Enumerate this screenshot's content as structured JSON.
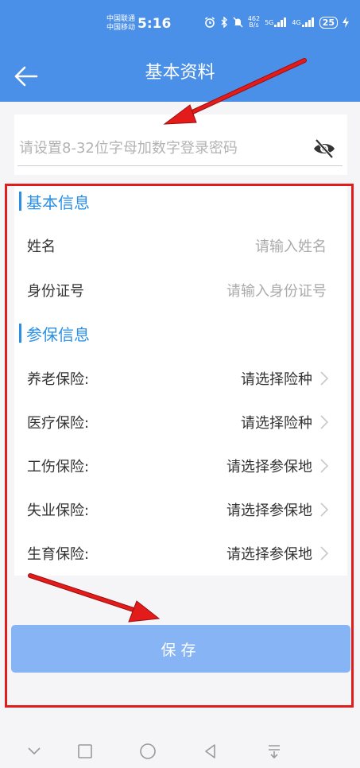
{
  "status_bar": {
    "carrier_1": "中国联通",
    "carrier_2": "中国移动",
    "time": "5:16",
    "net_speed_value": "462",
    "net_speed_unit": "B/s",
    "network_5g": "5G",
    "network_4g": "4G",
    "battery": "25"
  },
  "header": {
    "title": "基本资料"
  },
  "password": {
    "placeholder": "请设置8-32位字母加数字登录密码",
    "value": ""
  },
  "basic_info": {
    "section_title": "基本信息",
    "fields": [
      {
        "label": "姓名",
        "placeholder": "请输入姓名"
      },
      {
        "label": "身份证号",
        "placeholder": "请输入身份证号"
      }
    ]
  },
  "insurance_info": {
    "section_title": "参保信息",
    "items": [
      {
        "label": "养老保险:",
        "value": "请选择险种"
      },
      {
        "label": "医疗保险:",
        "value": "请选择险种"
      },
      {
        "label": "工伤保险:",
        "value": "请选择参保地"
      },
      {
        "label": "失业保险:",
        "value": "请选择参保地"
      },
      {
        "label": "生育保险:",
        "value": "请选择参保地"
      }
    ]
  },
  "save_button": {
    "label": "保存"
  },
  "colors": {
    "header_bg": "#4a90e8",
    "accent": "#2a8fe6",
    "save_button_bg": "#86b4f5",
    "annotation_red": "#e01c1c"
  }
}
